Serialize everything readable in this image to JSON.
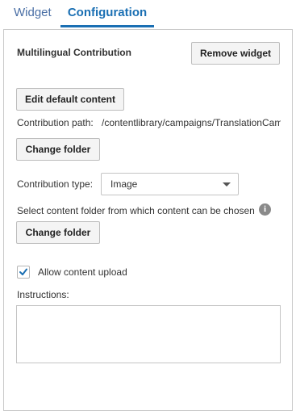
{
  "tabs": {
    "widget_label": "Widget",
    "configuration_label": "Configuration"
  },
  "panel": {
    "widget_title": "Multilingual Contribution",
    "remove_widget_label": "Remove widget",
    "edit_default_content_label": "Edit default content",
    "contribution_path_label": "Contribution path:",
    "contribution_path_value": "/contentlibrary/campaigns/TranslationCam",
    "change_folder_label_1": "Change folder",
    "contribution_type_label": "Contribution type:",
    "contribution_type_value": "Image",
    "select_folder_text": "Select content folder from which content can be chosen",
    "info_icon_glyph": "i",
    "change_folder_label_2": "Change folder",
    "allow_upload_label": "Allow content upload",
    "allow_upload_checked": true,
    "instructions_label": "Instructions:",
    "instructions_value": ""
  },
  "colors": {
    "accent": "#1a6fb3",
    "checkmark": "#1a6fb3",
    "border": "#c9c9c9"
  }
}
